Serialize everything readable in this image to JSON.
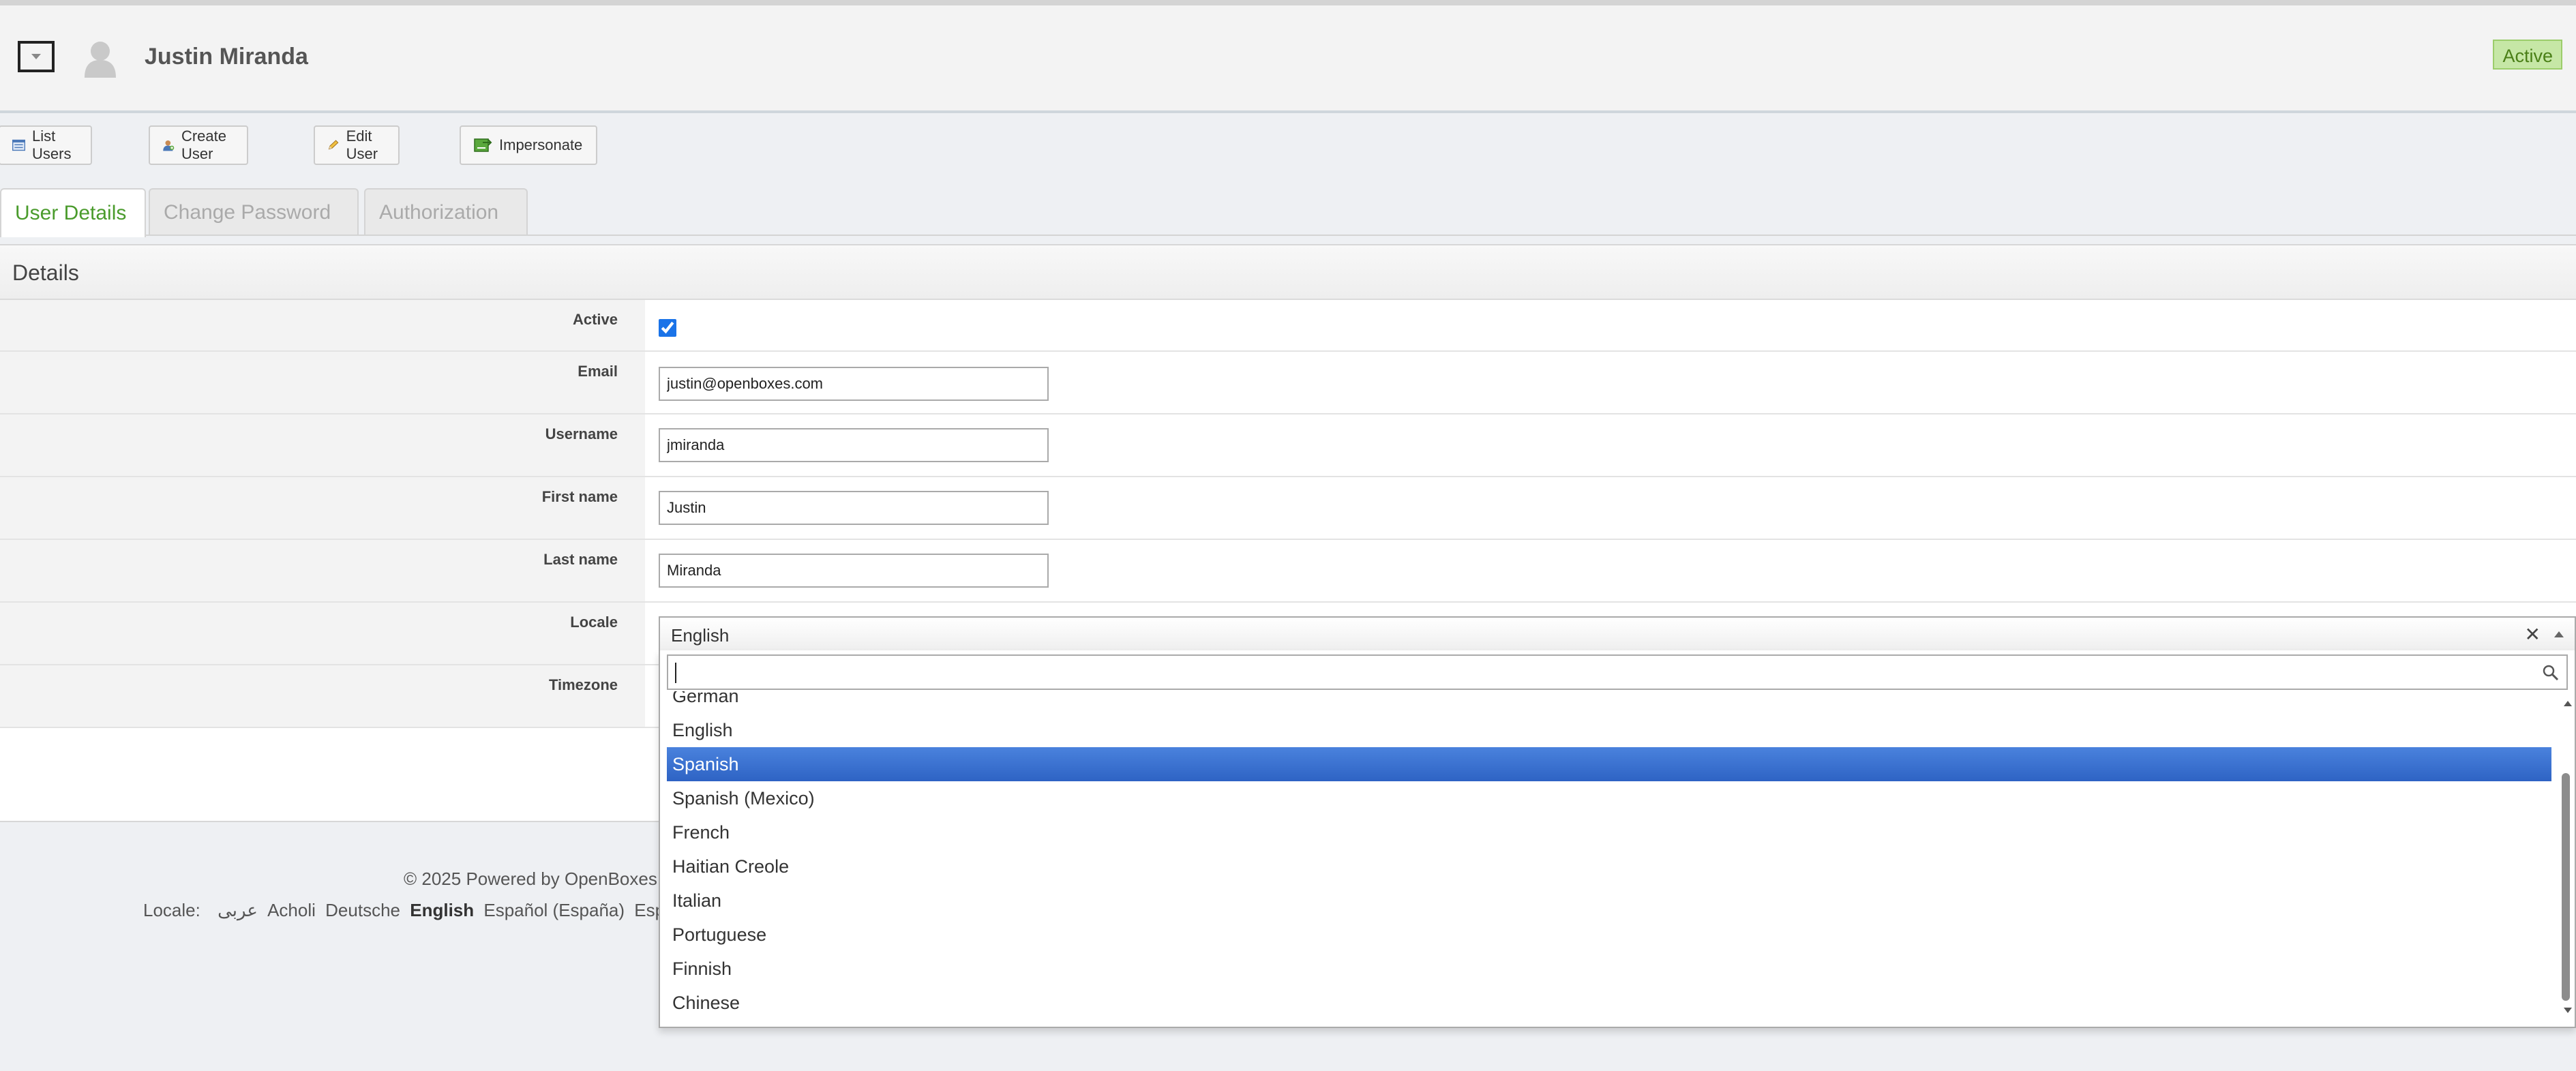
{
  "header": {
    "user_name": "Justin Miranda",
    "status": "Active"
  },
  "toolbar": {
    "list_users": "List Users",
    "create_user": "Create User",
    "edit_user": "Edit User",
    "impersonate": "Impersonate"
  },
  "tabs": [
    {
      "label": "User Details"
    },
    {
      "label": "Change Password"
    },
    {
      "label": "Authorization"
    }
  ],
  "details": {
    "title": "Details",
    "fields": [
      {
        "label": "Active",
        "checked": true
      },
      {
        "label": "Email",
        "value": "justin@openboxes.com"
      },
      {
        "label": "Username",
        "value": "jmiranda"
      },
      {
        "label": "First name",
        "value": "Justin"
      },
      {
        "label": "Last name",
        "value": "Miranda"
      },
      {
        "label": "Locale",
        "value": "English"
      },
      {
        "label": "Timezone"
      }
    ]
  },
  "locale_dropdown": {
    "selected": "English",
    "search_value": "",
    "highlighted": "Spanish",
    "options": [
      "German",
      "English",
      "Spanish",
      "Spanish (Mexico)",
      "French",
      "Haitian Creole",
      "Italian",
      "Portuguese",
      "Finnish",
      "Chinese"
    ]
  },
  "footer": {
    "powered_by": "© 2025 Powered by OpenBoxes",
    "locale_label": "Locale:",
    "locales": [
      "عربى",
      "Acholi",
      "Deutsche",
      "English",
      "Español (España)",
      "Español ("
    ],
    "current_locale": "English"
  },
  "colors": {
    "active_tab": "#4a9b2c",
    "highlight": "#3a71d3",
    "badge_bg": "#c6e7a6"
  }
}
